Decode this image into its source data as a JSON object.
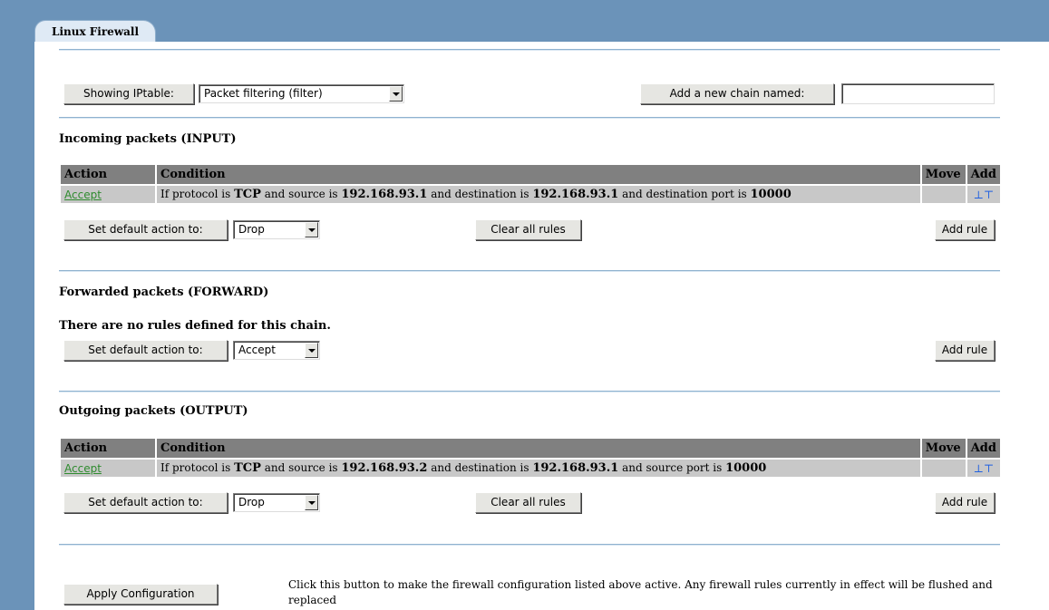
{
  "tab": {
    "label": "Linux Firewall"
  },
  "toolbar": {
    "showing_label": "Showing IPtable:",
    "iptable_value": "Packet filtering (filter)",
    "add_chain_label": "Add a new chain named:",
    "add_chain_value": ""
  },
  "columns": {
    "action": "Action",
    "condition": "Condition",
    "move": "Move",
    "add": "Add"
  },
  "common": {
    "set_default": "Set default action to:",
    "clear_all": "Clear all rules",
    "add_rule": "Add rule",
    "add_icons": "⊥⊤"
  },
  "input": {
    "title": "Incoming packets (INPUT)",
    "rule": {
      "action": "Accept",
      "c1": "If protocol is ",
      "proto": "TCP",
      "c2": " and source is ",
      "src": "192.168.93.1",
      "c3": " and destination is ",
      "dst": "192.168.93.1",
      "c4": " and destination port is ",
      "port": "10000"
    },
    "default_action": "Drop"
  },
  "forward": {
    "title": "Forwarded packets (FORWARD)",
    "empty_msg": "There are no rules defined for this chain.",
    "default_action": "Accept"
  },
  "output": {
    "title": "Outgoing packets (OUTPUT)",
    "rule": {
      "action": "Accept",
      "c1": "If protocol is ",
      "proto": "TCP",
      "c2": " and source is ",
      "src": "192.168.93.2",
      "c3": " and destination is ",
      "dst": "192.168.93.1",
      "c4": " and source port is ",
      "port": "10000"
    },
    "default_action": "Drop"
  },
  "apply": {
    "button": "Apply Configuration",
    "description": "Click this button to make the firewall configuration listed above active. Any firewall rules currently in effect will be flushed and replaced"
  },
  "colors": {
    "background": "#6b93b9",
    "panel": "#ffffff",
    "header_cell": "#808080",
    "row_cell": "#c8c8c8",
    "link": "#2e8b2e",
    "icon": "#2060e0"
  }
}
